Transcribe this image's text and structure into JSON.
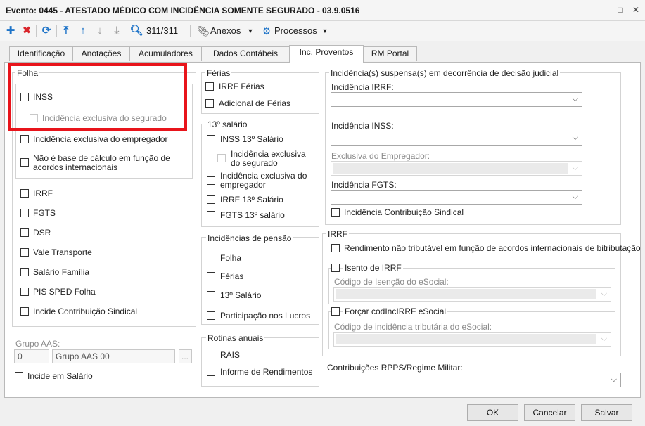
{
  "window": {
    "title": "Evento: 0445 - ATESTADO MÉDICO COM INCIDÊNCIA SOMENTE SEGURADO - 03.9.0516"
  },
  "toolbar": {
    "record_counter": "311/311",
    "attachments_label": "Anexos",
    "processes_label": "Processos"
  },
  "tabs": [
    {
      "label": "Identificação"
    },
    {
      "label": "Anotações"
    },
    {
      "label": "Acumuladores"
    },
    {
      "label": "Dados Contábeis"
    },
    {
      "label": "Inc. Proventos"
    },
    {
      "label": "RM Portal"
    }
  ],
  "folha": {
    "title": "Folha",
    "inss": "INSS",
    "inss_exclusiva_segurado": "Incidência exclusiva do segurado",
    "inc_exclusiva_empregador": "Incidência exclusiva do empregador",
    "nao_base": "Não é base de cálculo em função de acordos internacionais",
    "items": [
      "IRRF",
      "FGTS",
      "DSR",
      "Vale Transporte",
      "Salário Família",
      "PIS SPED Folha",
      "Incide Contribuição Sindical"
    ]
  },
  "grupo_aas": {
    "label": "Grupo AAS:",
    "code": "0",
    "name": "Grupo AAS 00",
    "lookup": "..."
  },
  "incide_salario": "Incide em Salário",
  "ferias": {
    "title": "Férias",
    "irrf": "IRRF Férias",
    "adicional": "Adicional de Férias"
  },
  "salario13": {
    "title": "13º salário",
    "inss": "INSS 13º Salário",
    "inc_segurado": "Incidência exclusiva do segurado",
    "inc_empregador": "Incidência exclusiva do empregador",
    "irrf": "IRRF 13º Salário",
    "fgts": "FGTS 13º salário"
  },
  "pensao": {
    "title": "Incidências de pensão",
    "items": [
      "Folha",
      "Férias",
      "13º Salário",
      "Participação nos Lucros"
    ]
  },
  "rotinas": {
    "title": "Rotinas anuais",
    "items": [
      "RAIS",
      "Informe de Rendimentos"
    ]
  },
  "suspensas": {
    "title": "Incidência(s) suspensa(s) em decorrência de decisão judicial",
    "irrf": "Incidência IRRF:",
    "inss": "Incidência INSS:",
    "empregador": "Exclusiva do Empregador:",
    "fgts": "Incidência FGTS:",
    "sindical": "Incidência Contribuição Sindical"
  },
  "irrf": {
    "title": "IRRF",
    "rendimento": "Rendimento não tributável em função de acordos internacionais de bitributação",
    "isento": "Isento de IRRF",
    "cod_isencao": "Código de Isenção do eSocial:",
    "forcar": "Forçar codIncIRRF eSocial",
    "cod_incidencia": "Código de incidência tributária do eSocial:"
  },
  "rpps": {
    "label": "Contribuições RPPS/Regime Militar:"
  },
  "footer": {
    "ok": "OK",
    "cancel": "Cancelar",
    "save": "Salvar"
  },
  "colors": {
    "accent": "#1f74c8",
    "delete": "#d9252b",
    "highlight": "#e8141b"
  }
}
